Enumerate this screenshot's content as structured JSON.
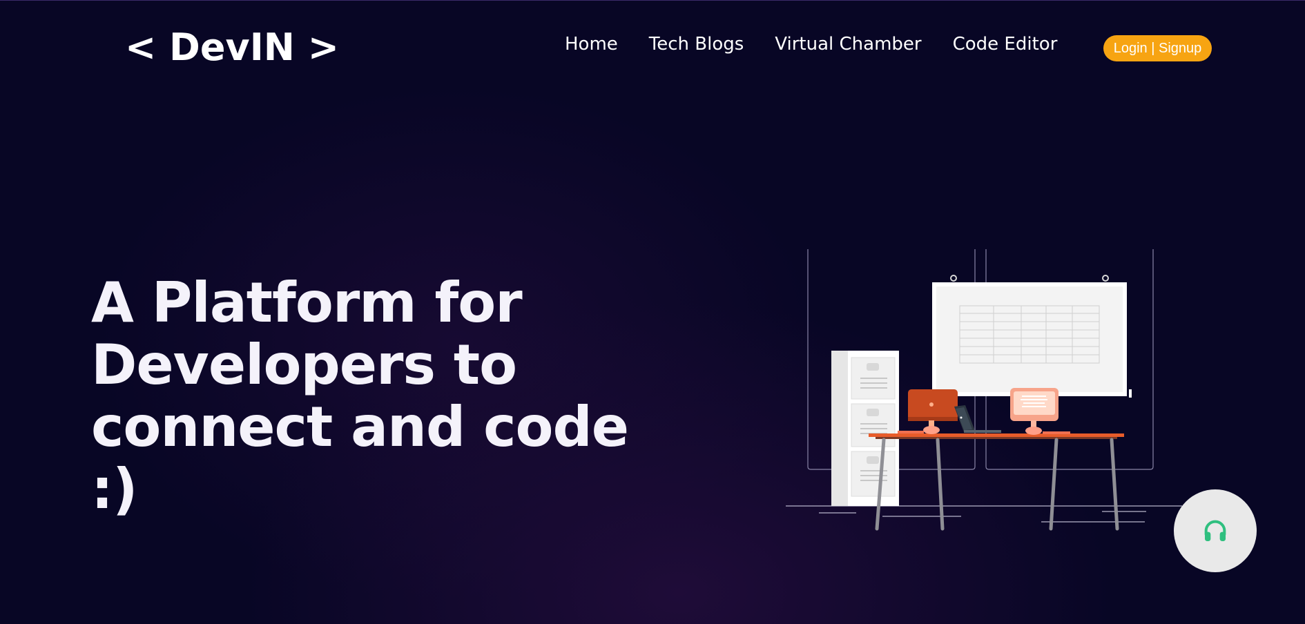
{
  "brand": {
    "logo_text": "< DevIN >"
  },
  "nav": {
    "items": [
      {
        "label": "Home"
      },
      {
        "label": "Tech Blogs"
      },
      {
        "label": "Virtual Chamber"
      },
      {
        "label": "Code Editor"
      }
    ],
    "login_label": "Login | Signup"
  },
  "hero": {
    "line1": "A Platform for",
    "line2": "Developers to",
    "line3": "connect and code :)"
  },
  "icons": {
    "support": "headphones-icon",
    "illustration": "office-desk-illustration"
  },
  "colors": {
    "background": "#080625",
    "accent": "#f7a412",
    "support_icon": "#2fbf7f",
    "support_bg": "#e9e9e9"
  }
}
